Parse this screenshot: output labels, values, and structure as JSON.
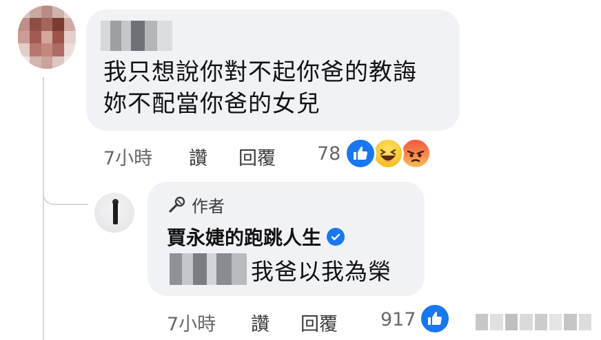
{
  "comment": {
    "text_lines": [
      "我只想說你對不起你爸的教誨",
      "妳不配當你爸的女兒"
    ],
    "time": "7小時",
    "like_action": "讚",
    "reply_action": "回覆",
    "reaction_count": "78",
    "reactions": [
      "like-icon",
      "haha-icon",
      "angry-icon"
    ]
  },
  "reply": {
    "author_badge": "作者",
    "author_name": "賈永婕的跑跳人生",
    "verified": true,
    "text": "我爸以我為榮",
    "time": "7小時",
    "like_action": "讚",
    "reply_action": "回覆",
    "reaction_count": "917",
    "reactions": [
      "like-icon"
    ]
  },
  "colors": {
    "bubble_bg": "#f0f2f5",
    "like_blue": "#1877f2",
    "meta_gray": "#65676b"
  }
}
